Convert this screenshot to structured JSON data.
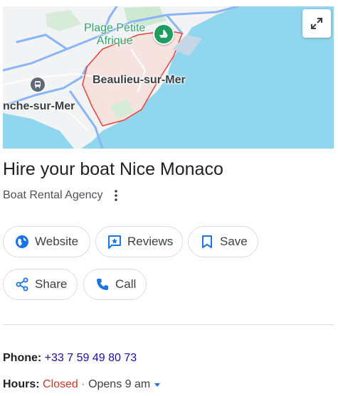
{
  "map": {
    "place_label_line1": "Plage Petite",
    "place_label_line2": "Afrique",
    "town_label": "Beaulieu-sur-Mer",
    "town2_label": "nche-sur-Mer",
    "expand_icon": "expand-icon",
    "colors": {
      "sea": "#8fd6ee",
      "land": "#f1f3f4",
      "road": "#8ab4f8",
      "boundary": "#ea4335",
      "pin": "#1e9e5e"
    }
  },
  "business": {
    "name": "Hire your boat Nice Monaco",
    "category": "Boat Rental Agency"
  },
  "actions": {
    "website": "Website",
    "reviews": "Reviews",
    "save": "Save",
    "share": "Share",
    "call": "Call"
  },
  "info": {
    "phone_label": "Phone:",
    "phone_value": "+33 7 59 49 80 73",
    "hours_label": "Hours:",
    "hours_status": "Closed",
    "hours_separator": "·",
    "hours_next": "Opens 9 am"
  }
}
